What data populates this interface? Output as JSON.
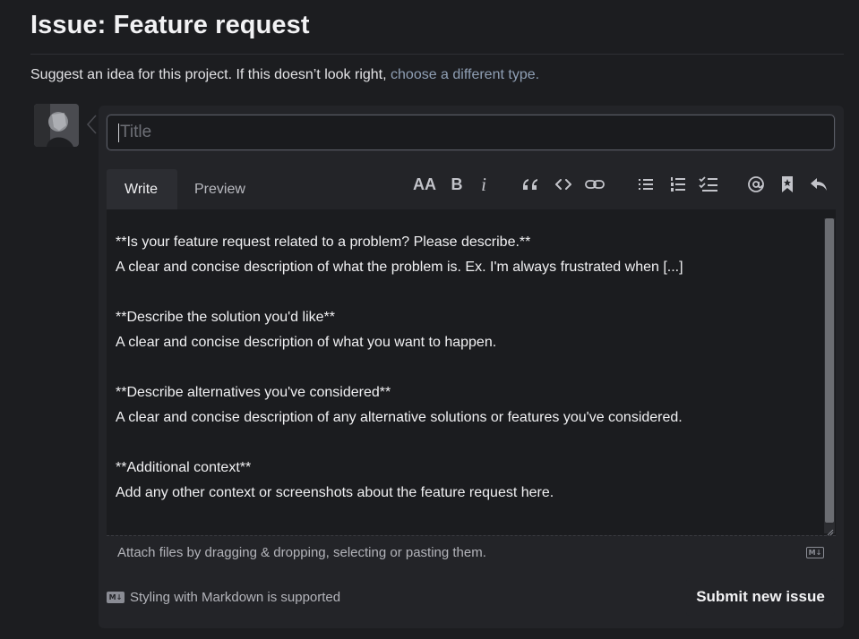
{
  "header": {
    "title": "Issue: Feature request",
    "intro_text": "Suggest an idea for this project. If this doesn’t look right,",
    "intro_link": "choose a different type."
  },
  "form": {
    "title_placeholder": "Title",
    "title_value": "",
    "tabs": [
      {
        "label": "Write",
        "active": true
      },
      {
        "label": "Preview",
        "active": false
      }
    ],
    "toolbar": {
      "heading_label": "AA",
      "bold_label": "B",
      "italic_label": "i",
      "icons": [
        "text-size-icon",
        "bold-icon",
        "italic-icon",
        "quote-icon",
        "code-icon",
        "link-icon",
        "unordered-list-icon",
        "ordered-list-icon",
        "task-list-icon",
        "mention-icon",
        "saved-reply-icon",
        "reply-icon"
      ]
    },
    "body": "**Is your feature request related to a problem? Please describe.**\nA clear and concise description of what the problem is. Ex. I'm always frustrated when [...]\n\n**Describe the solution you'd like**\nA clear and concise description of what you want to happen.\n\n**Describe alternatives you've considered**\nA clear and concise description of any alternative solutions or features you've considered.\n\n**Additional context**\nAdd any other context or screenshots about the feature request here.",
    "attach_text": "Attach files by dragging & dropping, selecting or pasting them.",
    "markdown_note": "Styling with Markdown is supported",
    "markdown_badge": "M↓",
    "submit_label": "Submit new issue"
  },
  "colors": {
    "background": "#1c1d20",
    "panel": "#232428",
    "link": "#8f9fb4",
    "input_border": "#5a5d66"
  }
}
